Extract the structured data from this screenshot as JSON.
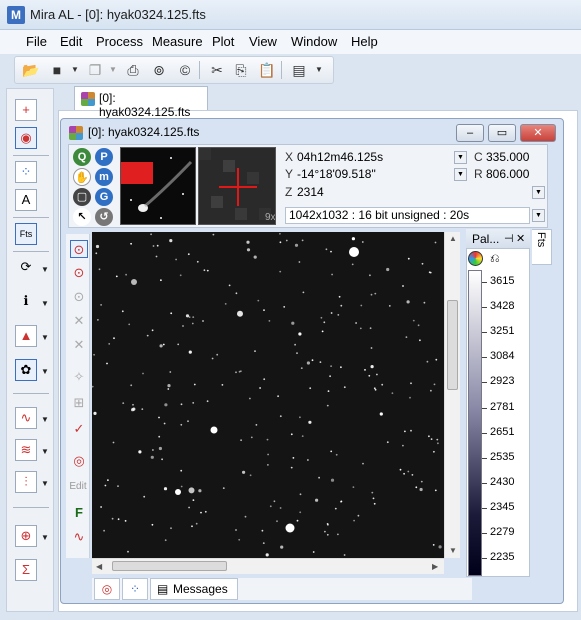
{
  "app": {
    "title": "Mira AL - [0]: hyak0324.125.fts",
    "icon_letter": "M"
  },
  "menu": [
    "File",
    "Edit",
    "Process",
    "Measure",
    "Plot",
    "View",
    "Window",
    "Help"
  ],
  "document_tab": {
    "label": "[0]: hyak0324.125.fts"
  },
  "inner_window": {
    "title": "[0]: hyak0324.125.fts",
    "buttons": {
      "minimize": "–",
      "restore": "▭",
      "close": "✕"
    }
  },
  "controls": {
    "round_buttons": [
      "Q",
      "P",
      "✋",
      "m",
      "▢",
      "G",
      "↖",
      "↺"
    ],
    "zoom_label": "9x"
  },
  "coords": {
    "x_label": "X",
    "x_value": "04h12m46.125s",
    "y_label": "Y",
    "y_value": "-14°18'09.518\"",
    "z_label": "Z",
    "z_value": "2314",
    "c_label": "C",
    "c_value": "335.000",
    "r_label": "R",
    "r_value": "806.000",
    "image_info": "1042x1032 : 16 bit unsigned : 20s"
  },
  "left_tools": [
    "⊙",
    "⊙",
    "⊙",
    "✕",
    "✕",
    "✧",
    "⊞",
    "✓",
    "◎",
    "Edit",
    "F",
    "∿"
  ],
  "palette": {
    "title": "Pal...",
    "pin": "⊣",
    "close": "✕",
    "ticks": [
      "3615",
      "3428",
      "3251",
      "3084",
      "2923",
      "2781",
      "2651",
      "2535",
      "2430",
      "2345",
      "2279",
      "2235"
    ]
  },
  "side_tab": "Fts",
  "bottom_tabs": {
    "messages": "Messages"
  },
  "colors": {
    "accent": "#3c6fbf",
    "close_red": "#c8413a",
    "crosshair": "#e01818"
  },
  "icons": {
    "left_toolbar": [
      "add-point-icon",
      "target-icon",
      "scatter-icon",
      "annotate-icon",
      "fts-icon",
      "refresh-icon",
      "info-icon",
      "histogram-icon",
      "palette-icon",
      "plot-icon",
      "plot2-icon",
      "profile-icon",
      "crosshair-icon",
      "sigma-icon"
    ]
  }
}
